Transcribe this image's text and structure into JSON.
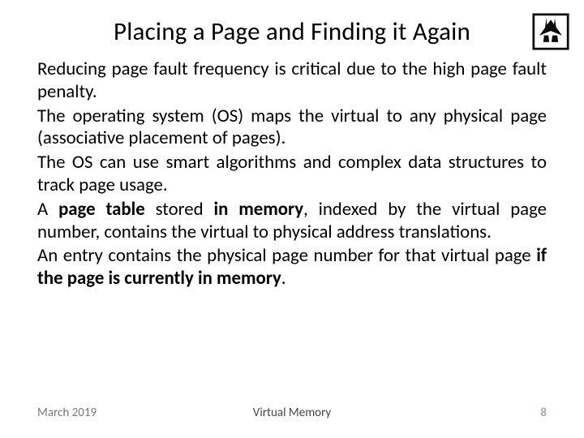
{
  "title": "Placing a Page and Finding it Again",
  "paragraphs": {
    "p1": "Reducing page fault frequency is critical due to the high page fault penalty.",
    "p2": "The operating system (OS) maps the virtual to any physical page (associative placement of pages).",
    "p3": "The OS can use smart algorithms and complex data structures to track page usage.",
    "p4a": "A ",
    "p4b": "page table",
    "p4c": " stored ",
    "p4d": "in memory",
    "p4e": ", indexed by the virtual page number, contains the virtual to physical address translations.",
    "p5a": "An entry contains the physical page number for that virtual page ",
    "p5b": "if the page is currently in memory",
    "p5c": "."
  },
  "footer": {
    "date": "March 2019",
    "topic": "Virtual Memory",
    "page": "8"
  }
}
